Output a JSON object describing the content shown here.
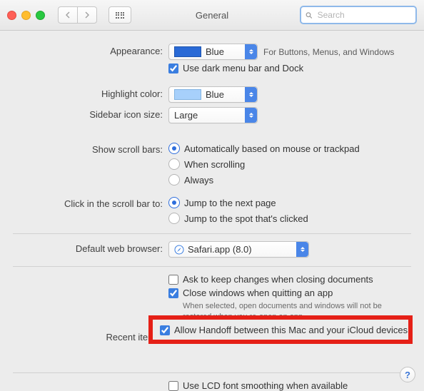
{
  "window": {
    "title": "General"
  },
  "search": {
    "placeholder": "Search"
  },
  "appearance": {
    "label": "Appearance:",
    "value": "Blue",
    "hint": "For Buttons, Menus, and Windows",
    "darkmenu": "Use dark menu bar and Dock"
  },
  "highlight": {
    "label": "Highlight color:",
    "value": "Blue"
  },
  "sidebar": {
    "label": "Sidebar icon size:",
    "value": "Large"
  },
  "scrollbars": {
    "label": "Show scroll bars:",
    "opts": [
      "Automatically based on mouse or trackpad",
      "When scrolling",
      "Always"
    ]
  },
  "click_scroll": {
    "label": "Click in the scroll bar to:",
    "opts": [
      "Jump to the next page",
      "Jump to the spot that's clicked"
    ]
  },
  "browser": {
    "label": "Default web browser:",
    "value": "Safari.app (8.0)"
  },
  "docs": {
    "ask": "Ask to keep changes when closing documents",
    "close": "Close windows when quitting an app",
    "close_note": "When selected, open documents and windows will not be restored when you re-open an app."
  },
  "recent": {
    "label": "Recent items:"
  },
  "handoff": "Allow Handoff between this Mac and your iCloud devices",
  "lcd": "Use LCD font smoothing when available"
}
